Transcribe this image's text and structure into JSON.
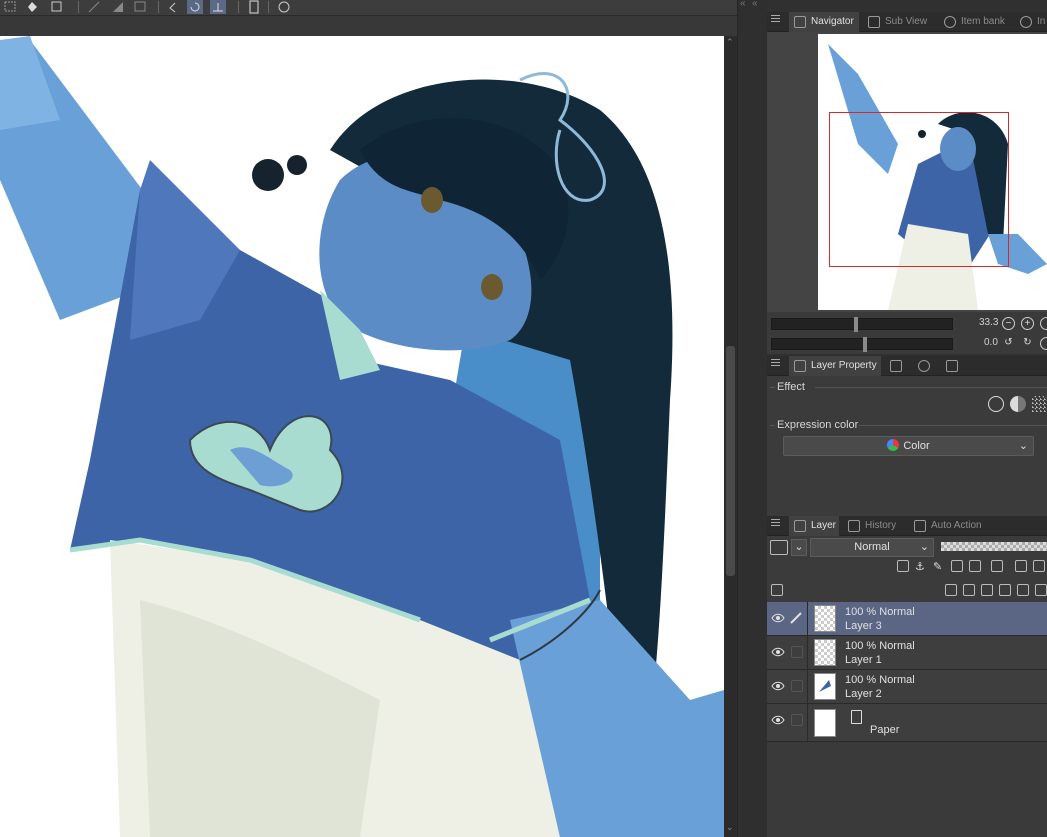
{
  "colors": {
    "selection": "#5b6584",
    "panel_bg": "#3b3b3b",
    "canvas_bg": "#ffffff",
    "navigator_frame": "#d22b2b"
  },
  "navigator_panel": {
    "tabs": [
      {
        "label": "Navigator",
        "icon": "navigator-icon"
      },
      {
        "label": "Sub View",
        "icon": "sub-view-icon"
      },
      {
        "label": "Item bank",
        "icon": "item-bank-icon"
      },
      {
        "label": "In",
        "icon": "info-icon"
      }
    ],
    "zoom_value": "33.3",
    "rotate_value": "0.0"
  },
  "layer_property_panel": {
    "tab_label": "Layer Property",
    "effect_label": "Effect",
    "expression_color_label": "Expression color",
    "expression_color_value": "Color"
  },
  "layer_panel": {
    "tabs": [
      {
        "label": "Layer",
        "icon": "layer-icon"
      },
      {
        "label": "History",
        "icon": "history-icon"
      },
      {
        "label": "Auto Action",
        "icon": "auto-action-icon"
      }
    ],
    "blend_mode": "Normal",
    "layers": [
      {
        "line1": "100 % Normal",
        "line2": "Layer 3",
        "selected": true
      },
      {
        "line1": "100 % Normal",
        "line2": "Layer 1",
        "selected": false
      },
      {
        "line1": "100 % Normal",
        "line2": "Layer 2",
        "selected": false
      }
    ],
    "paper_layer": "Paper"
  }
}
